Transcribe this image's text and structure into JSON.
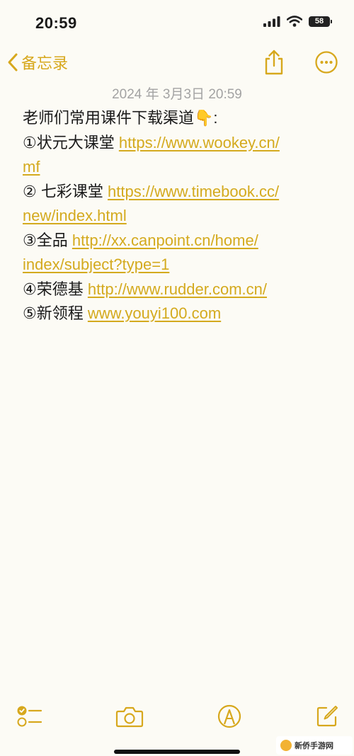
{
  "status": {
    "time": "20:59",
    "battery": "58"
  },
  "nav": {
    "back_label": "备忘录"
  },
  "note": {
    "date": "2024 年 3月3日 20:59",
    "title": "老师们常用课件下载渠道👇:",
    "entries": [
      {
        "num": "①",
        "name": "状元大课堂",
        "link1": "https://www.wookey.cn/",
        "link2": "mf"
      },
      {
        "num": "②",
        "name": "七彩课堂",
        "link1": "https://www.timebook.cc/",
        "link2": "new/index.html"
      },
      {
        "num": "③",
        "name": "全品",
        "link1": "http://xx.canpoint.cn/home/",
        "link2": "index/subject?type=1"
      },
      {
        "num": "④",
        "name": "荣德基",
        "link1": "http://www.rudder.com.cn/"
      },
      {
        "num": "⑤",
        "name": "新领程",
        "link1": "www.youyi100.com"
      }
    ]
  },
  "watermark": {
    "text": "新侨手游网"
  },
  "colors": {
    "accent": "#d7a81d",
    "background": "#fcfbf5",
    "date_gray": "#a3a3a3"
  }
}
